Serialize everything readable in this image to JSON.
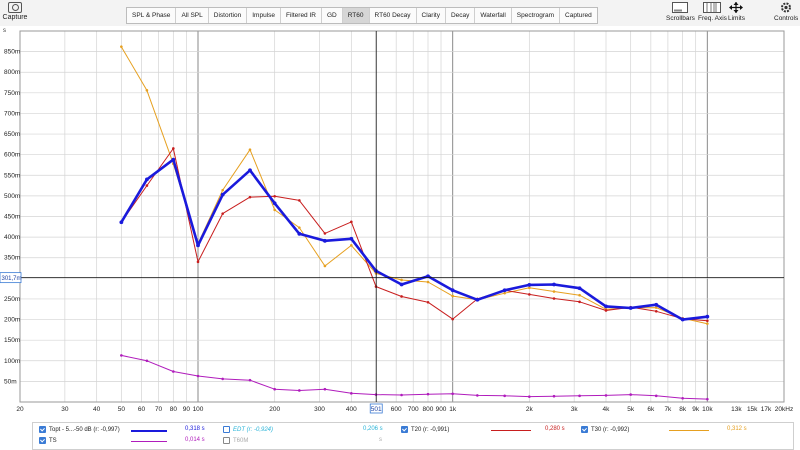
{
  "toolbar": {
    "capture_label": "Capture",
    "tabs": [
      {
        "label": "SPL & Phase"
      },
      {
        "label": "All SPL"
      },
      {
        "label": "Distortion"
      },
      {
        "label": "Impulse"
      },
      {
        "label": "Filtered IR"
      },
      {
        "label": "GD"
      },
      {
        "label": "RT60",
        "active": true
      },
      {
        "label": "RT60 Decay"
      },
      {
        "label": "Clarity"
      },
      {
        "label": "Decay"
      },
      {
        "label": "Waterfall"
      },
      {
        "label": "Spectrogram"
      },
      {
        "label": "Captured"
      }
    ],
    "right_tools": [
      {
        "label": "Scrollbars",
        "icon": "scrollbars-icon"
      },
      {
        "label": "Freq. Axis",
        "icon": "freq-axis-icon"
      },
      {
        "label": "Limits",
        "icon": "limits-icon"
      },
      {
        "label": "Controls",
        "icon": "controls-icon"
      }
    ]
  },
  "chart_data": {
    "type": "line",
    "y_unit": "s",
    "x_scale": "log",
    "xlim": [
      20,
      20000
    ],
    "ylim": [
      0,
      0.9
    ],
    "x_ticks": [
      {
        "v": 20,
        "label": "20"
      },
      {
        "v": 30,
        "label": "30"
      },
      {
        "v": 40,
        "label": "40"
      },
      {
        "v": 50,
        "label": "50"
      },
      {
        "v": 60,
        "label": "60"
      },
      {
        "v": 70,
        "label": "70"
      },
      {
        "v": 80,
        "label": "80"
      },
      {
        "v": 90,
        "label": "90"
      },
      {
        "v": 100,
        "label": "100"
      },
      {
        "v": 200,
        "label": "200"
      },
      {
        "v": 300,
        "label": "300"
      },
      {
        "v": 400,
        "label": "400"
      },
      {
        "v": 600,
        "label": "600"
      },
      {
        "v": 700,
        "label": "700"
      },
      {
        "v": 800,
        "label": "800"
      },
      {
        "v": 900,
        "label": "900"
      },
      {
        "v": 1000,
        "label": "1k"
      },
      {
        "v": 2000,
        "label": "2k"
      },
      {
        "v": 3000,
        "label": "3k"
      },
      {
        "v": 4000,
        "label": "4k"
      },
      {
        "v": 5000,
        "label": "5k"
      },
      {
        "v": 6000,
        "label": "6k"
      },
      {
        "v": 7000,
        "label": "7k"
      },
      {
        "v": 8000,
        "label": "8k"
      },
      {
        "v": 9000,
        "label": "9k"
      },
      {
        "v": 10000,
        "label": "10k"
      },
      {
        "v": 13000,
        "label": "13k"
      },
      {
        "v": 15000,
        "label": "15k"
      },
      {
        "v": 17000,
        "label": "17k"
      },
      {
        "v": 20000,
        "label": "20kHz"
      }
    ],
    "y_ticks": [
      {
        "v": 0.05,
        "label": "50m"
      },
      {
        "v": 0.1,
        "label": "100m"
      },
      {
        "v": 0.15,
        "label": "150m"
      },
      {
        "v": 0.2,
        "label": "200m"
      },
      {
        "v": 0.25,
        "label": "250m"
      },
      {
        "v": 0.35,
        "label": "350m"
      },
      {
        "v": 0.4,
        "label": "400m"
      },
      {
        "v": 0.45,
        "label": "450m"
      },
      {
        "v": 0.5,
        "label": "500m"
      },
      {
        "v": 0.55,
        "label": "550m"
      },
      {
        "v": 0.6,
        "label": "600m"
      },
      {
        "v": 0.65,
        "label": "650m"
      },
      {
        "v": 0.7,
        "label": "700m"
      },
      {
        "v": 0.75,
        "label": "750m"
      },
      {
        "v": 0.8,
        "label": "800m"
      },
      {
        "v": 0.85,
        "label": "850m"
      }
    ],
    "cursor": {
      "x": 501,
      "y": 0.3017,
      "x_label": "501",
      "y_label": "301,7m"
    },
    "x": [
      50,
      63,
      80,
      100,
      125,
      160,
      200,
      250,
      315,
      400,
      500,
      630,
      800,
      1000,
      1250,
      1600,
      2000,
      2500,
      3150,
      4000,
      5000,
      6300,
      8000,
      10000
    ],
    "series": [
      {
        "name": "Topt",
        "color": "#1a1adc",
        "width": 2.6,
        "values": [
          0.436,
          0.54,
          0.588,
          0.38,
          0.503,
          0.562,
          0.482,
          0.408,
          0.391,
          0.396,
          0.318,
          0.285,
          0.305,
          0.271,
          0.248,
          0.271,
          0.284,
          0.285,
          0.276,
          0.232,
          0.228,
          0.236,
          0.2,
          0.207
        ]
      },
      {
        "name": "T20",
        "color": "#c81e1e",
        "width": 1.0,
        "values": [
          0.436,
          0.525,
          0.615,
          0.34,
          0.457,
          0.497,
          0.499,
          0.489,
          0.409,
          0.437,
          0.28,
          0.256,
          0.242,
          0.201,
          0.25,
          0.271,
          0.261,
          0.251,
          0.243,
          0.222,
          0.23,
          0.22,
          0.202,
          0.197
        ]
      },
      {
        "name": "T30",
        "color": "#e6a020",
        "width": 1.0,
        "values": [
          0.862,
          0.756,
          0.578,
          0.384,
          0.514,
          0.612,
          0.466,
          0.423,
          0.33,
          0.38,
          0.312,
          0.296,
          0.291,
          0.257,
          0.248,
          0.264,
          0.277,
          0.268,
          0.259,
          0.225,
          0.228,
          0.229,
          0.203,
          0.19
        ]
      },
      {
        "name": "TS",
        "color": "#b01cbc",
        "width": 1.0,
        "values": [
          0.113,
          0.1,
          0.074,
          0.063,
          0.056,
          0.053,
          0.031,
          0.028,
          0.031,
          0.021,
          0.018,
          0.017,
          0.019,
          0.02,
          0.016,
          0.015,
          0.013,
          0.014,
          0.015,
          0.016,
          0.018,
          0.015,
          0.009,
          0.007
        ]
      }
    ]
  },
  "legend": {
    "items": [
      {
        "name": "Topt - 5...-50 dB (r: -0,997)",
        "value": "0,318 s",
        "color": "#1a1adc",
        "checked": true,
        "width": 2.6
      },
      {
        "name": "EDT (r: -0,924)",
        "value": "0,206 s",
        "color": "#2ab4d8",
        "checked": false,
        "width": 1.0
      },
      {
        "name": "T20 (r: -0,991)",
        "value": "0,280 s",
        "color": "#c81e1e",
        "checked": true,
        "width": 1.0
      },
      {
        "name": "T30 (r: -0,992)",
        "value": "0,312 s",
        "color": "#e6a020",
        "checked": true,
        "width": 1.0
      },
      {
        "name": "TS",
        "value": "0,014 s",
        "color": "#b01cbc",
        "checked": true,
        "width": 1.0
      },
      {
        "name": "T60M",
        "value": "s",
        "color": "#bcbcbc",
        "checked": false,
        "width": 1.0
      }
    ]
  }
}
